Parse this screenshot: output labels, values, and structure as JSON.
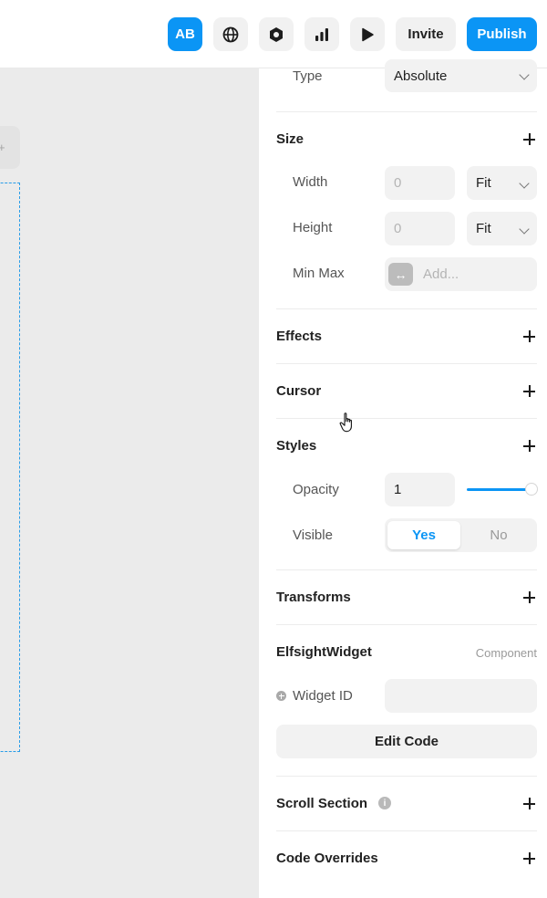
{
  "topbar": {
    "avatar_initials": "AB",
    "globe_icon": "globe-icon",
    "hex_icon": "hexagon-icon",
    "analytics_icon": "bar-chart-icon",
    "preview_icon": "play-icon",
    "invite_label": "Invite",
    "publish_label": "Publish"
  },
  "panel": {
    "position": {
      "type_label": "Type",
      "type_value": "Absolute"
    },
    "size": {
      "title": "Size",
      "width_label": "Width",
      "width_value": "0",
      "width_mode": "Fit",
      "height_label": "Height",
      "height_value": "0",
      "height_mode": "Fit",
      "minmax_label": "Min Max",
      "minmax_placeholder": "Add..."
    },
    "effects_title": "Effects",
    "cursor_title": "Cursor",
    "styles": {
      "title": "Styles",
      "opacity_label": "Opacity",
      "opacity_value": "1",
      "opacity_level": 1.0,
      "visible_label": "Visible",
      "visible_yes": "Yes",
      "visible_no": "No",
      "visible_selected": "Yes"
    },
    "transforms_title": "Transforms",
    "component": {
      "title": "ElfsightWidget",
      "badge": "Component",
      "widget_id_label": "Widget ID",
      "widget_id_value": "",
      "edit_code_label": "Edit Code"
    },
    "scroll_section_title": "Scroll Section",
    "code_overrides_title": "Code Overrides"
  },
  "colors": {
    "accent": "#0b95f5",
    "canvas_bg": "#ebebeb",
    "frame_outline": "#2a9de8"
  }
}
